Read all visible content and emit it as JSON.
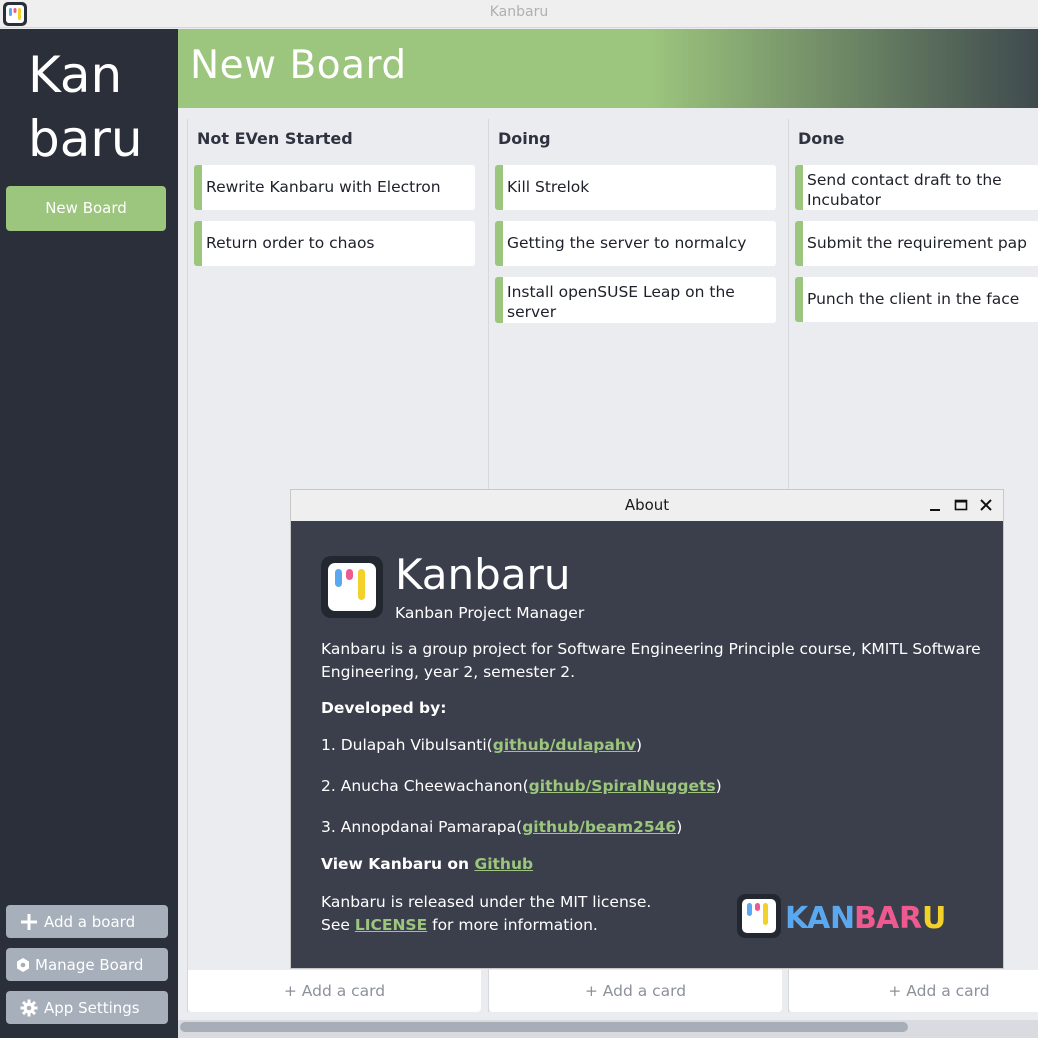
{
  "window": {
    "title": "Kanbaru"
  },
  "sidebar": {
    "brand_line1": "Kan",
    "brand_line2": "baru",
    "new_board_label": "New Board",
    "add_board_label": "Add a board",
    "manage_board_label": "Manage Board",
    "app_settings_label": "App Settings"
  },
  "board": {
    "title": "New Board",
    "add_card_label": "+ Add a card",
    "columns": [
      {
        "title": "Not EVen Started",
        "cards": [
          "Rewrite Kanbaru with Electron",
          "Return order to chaos"
        ]
      },
      {
        "title": "Doing",
        "cards": [
          "Kill Strelok",
          "Getting the server to normalcy",
          "Install openSUSE Leap on the server"
        ]
      },
      {
        "title": "Done",
        "cards": [
          "Send contact draft to the Incubator",
          "Submit the requirement pap",
          "Punch the client in the face"
        ]
      }
    ]
  },
  "about": {
    "window_title": "About",
    "app_name": "Kanbaru",
    "tagline": "Kanban Project Manager",
    "description": "Kanbaru is a group project for Software Engineering Principle course, KMITL Software Engineering, year 2, semester 2.",
    "developed_by": "Developed by:",
    "developers": [
      {
        "prefix": "1. Dulapah Vibulsanti(",
        "link": "github/dulapahv",
        "suffix": ")"
      },
      {
        "prefix": "2. Anucha Cheewachanon(",
        "link": "github/SpiralNuggets",
        "suffix": ")"
      },
      {
        "prefix": "3. Annopdanai Pamarapa(",
        "link": "github/beam2546",
        "suffix": ")"
      }
    ],
    "view_on": "View Kanbaru on ",
    "github_link": "Github",
    "license_line1": "Kanbaru is released under the MIT license.",
    "license_see": "See ",
    "license_link": "LICENSE",
    "license_rest": " for more information.",
    "wordmark": "KANBARU"
  },
  "colors": {
    "accent": "#9cc57d",
    "sidebar_bg": "#2a2f3a",
    "dialog_bg": "#3a3f4b",
    "logo_blue": "#5aa9f0",
    "logo_pink": "#ee5a8f",
    "logo_yellow": "#f2d12a"
  }
}
